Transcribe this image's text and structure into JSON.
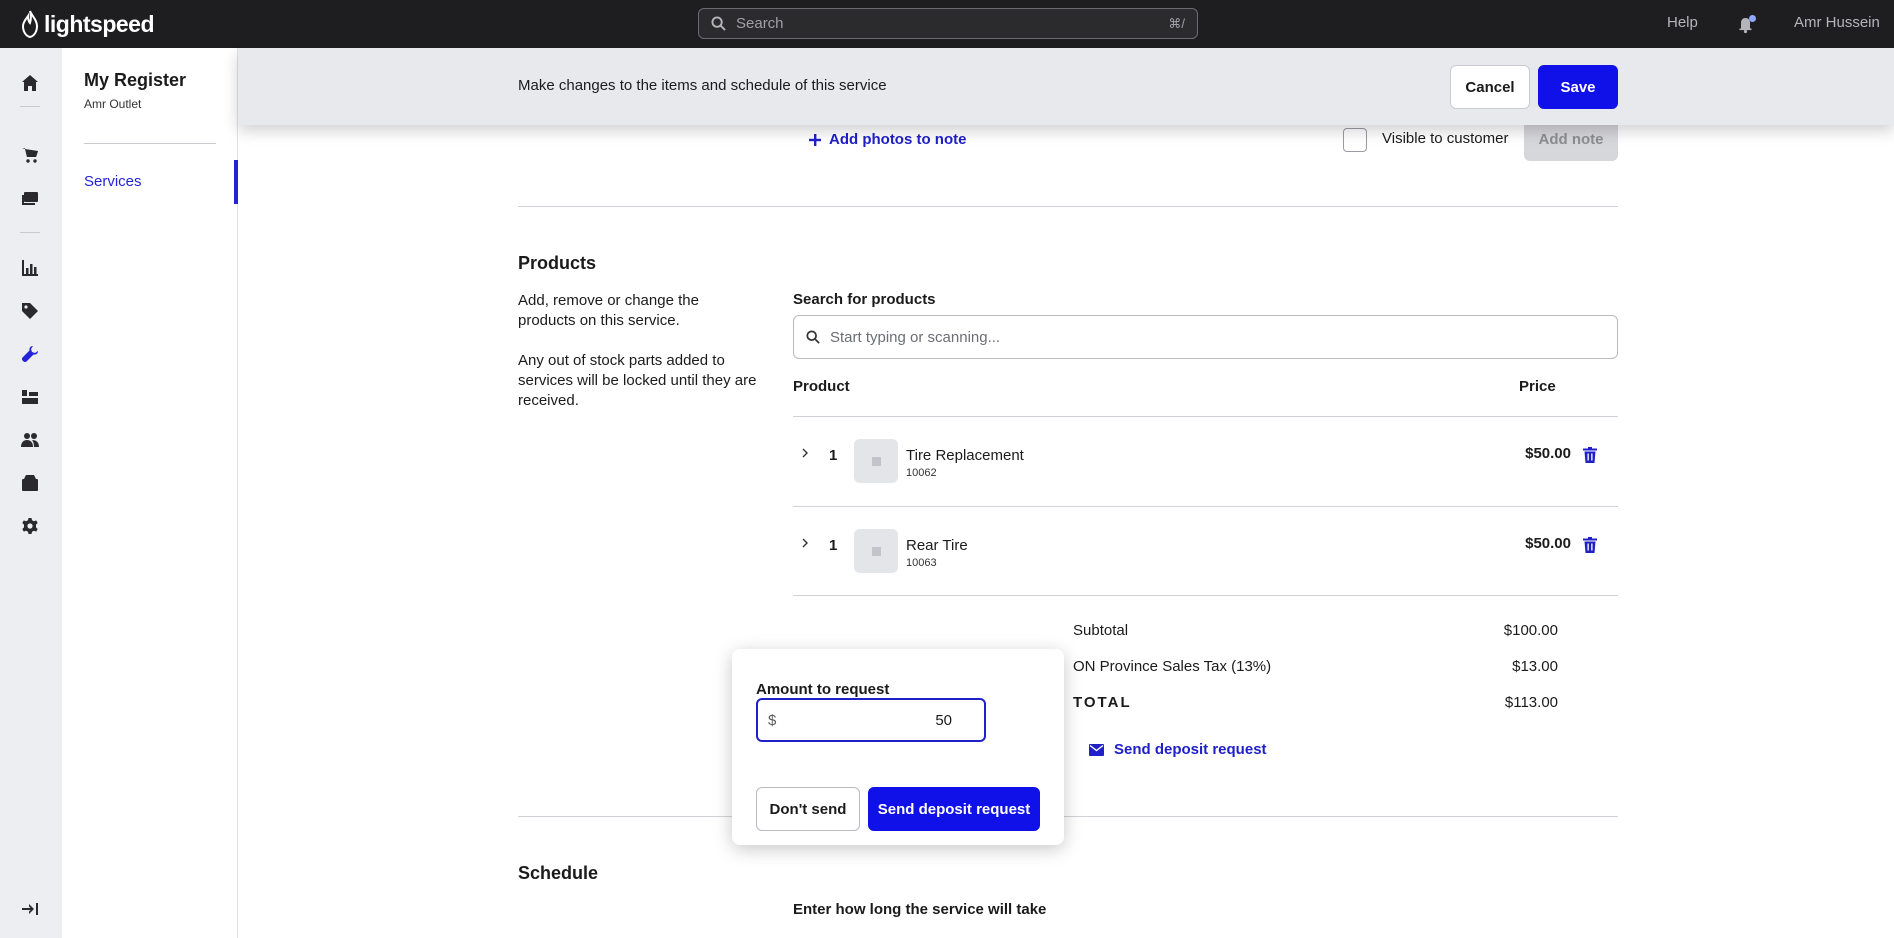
{
  "topbar": {
    "logo": "lightspeed",
    "search_placeholder": "Search",
    "search_shortcut": "⌘/",
    "help": "Help",
    "user": "Amr Hussein"
  },
  "rail": {
    "icons": [
      "home-icon",
      "cart-icon",
      "register-icon",
      "reports-icon",
      "tag-icon",
      "wrench-icon",
      "inventory-icon",
      "customers-icon",
      "ecommerce-icon",
      "settings-icon",
      "collapse-icon"
    ],
    "active": "wrench-icon"
  },
  "subnav": {
    "title": "My Register",
    "subtitle": "Amr Outlet",
    "items": [
      {
        "label": "Services",
        "active": true
      }
    ]
  },
  "actionbar": {
    "message": "Make changes to the items and schedule of this service",
    "cancel": "Cancel",
    "save": "Save"
  },
  "notes": {
    "add_photos": "Add photos to note",
    "visible_label": "Visible to customer",
    "add_note": "Add note"
  },
  "products": {
    "title": "Products",
    "desc1": "Add, remove or change the products on this service.",
    "desc2": "Any out of stock parts added to services will be locked until they are received.",
    "search_label": "Search for products",
    "search_placeholder": "Start typing or scanning...",
    "col_product": "Product",
    "col_price": "Price",
    "rows": [
      {
        "qty": "1",
        "name": "Tire Replacement",
        "sku": "10062",
        "price": "$50.00"
      },
      {
        "qty": "1",
        "name": "Rear Tire",
        "sku": "10063",
        "price": "$50.00"
      }
    ]
  },
  "totals": {
    "subtotal_label": "Subtotal",
    "subtotal": "$100.00",
    "tax_label": "ON Province Sales Tax (13%)",
    "tax": "$13.00",
    "total_label": "TOTAL",
    "total": "$113.00",
    "send_deposit": "Send deposit request"
  },
  "popover": {
    "label": "Amount to request",
    "currency": "$",
    "amount": "50",
    "dont_send": "Don't send",
    "send": "Send deposit request"
  },
  "schedule": {
    "title": "Schedule",
    "subtitle": "Enter how long the service will take"
  },
  "colors": {
    "accent": "#1010e8",
    "topbar": "#1e1e20"
  }
}
